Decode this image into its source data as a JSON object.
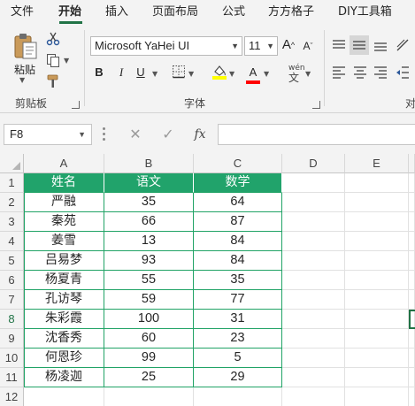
{
  "tabs": [
    "文件",
    "开始",
    "插入",
    "页面布局",
    "公式",
    "方方格子",
    "DIY工具箱"
  ],
  "active_tab": "开始",
  "ribbon": {
    "clipboard": {
      "paste_label": "粘贴",
      "group_label": "剪贴板"
    },
    "font": {
      "font_name": "Microsoft YaHei UI",
      "font_size": "11",
      "bold": "B",
      "italic": "I",
      "underline": "U",
      "grow": "A",
      "shrink": "A",
      "font_color_glyph": "A",
      "phonetic": "wén",
      "group_label": "字体",
      "fill_color": "#ffff00",
      "font_color": "#ff0000"
    },
    "alignment": {
      "group_label": "对"
    }
  },
  "formula_bar": {
    "name_box": "F8",
    "fx_label": "fx",
    "formula": ""
  },
  "grid": {
    "columns": [
      "A",
      "B",
      "C",
      "D",
      "E"
    ],
    "rows": [
      "1",
      "2",
      "3",
      "4",
      "5",
      "6",
      "7",
      "8",
      "9",
      "10",
      "11",
      "12"
    ],
    "selected_row": "8",
    "table_header": [
      "姓名",
      "语文",
      "数学"
    ],
    "table_rows": [
      [
        "严融",
        "35",
        "64"
      ],
      [
        "秦苑",
        "66",
        "87"
      ],
      [
        "姜雪",
        "13",
        "84"
      ],
      [
        "吕易梦",
        "93",
        "84"
      ],
      [
        "杨夏青",
        "55",
        "35"
      ],
      [
        "孔访琴",
        "59",
        "77"
      ],
      [
        "朱彩霞",
        "100",
        "31"
      ],
      [
        "沈香秀",
        "60",
        "23"
      ],
      [
        "何恩珍",
        "99",
        "5"
      ],
      [
        "杨凌迦",
        "25",
        "29"
      ]
    ],
    "accent_color": "#21a366"
  }
}
